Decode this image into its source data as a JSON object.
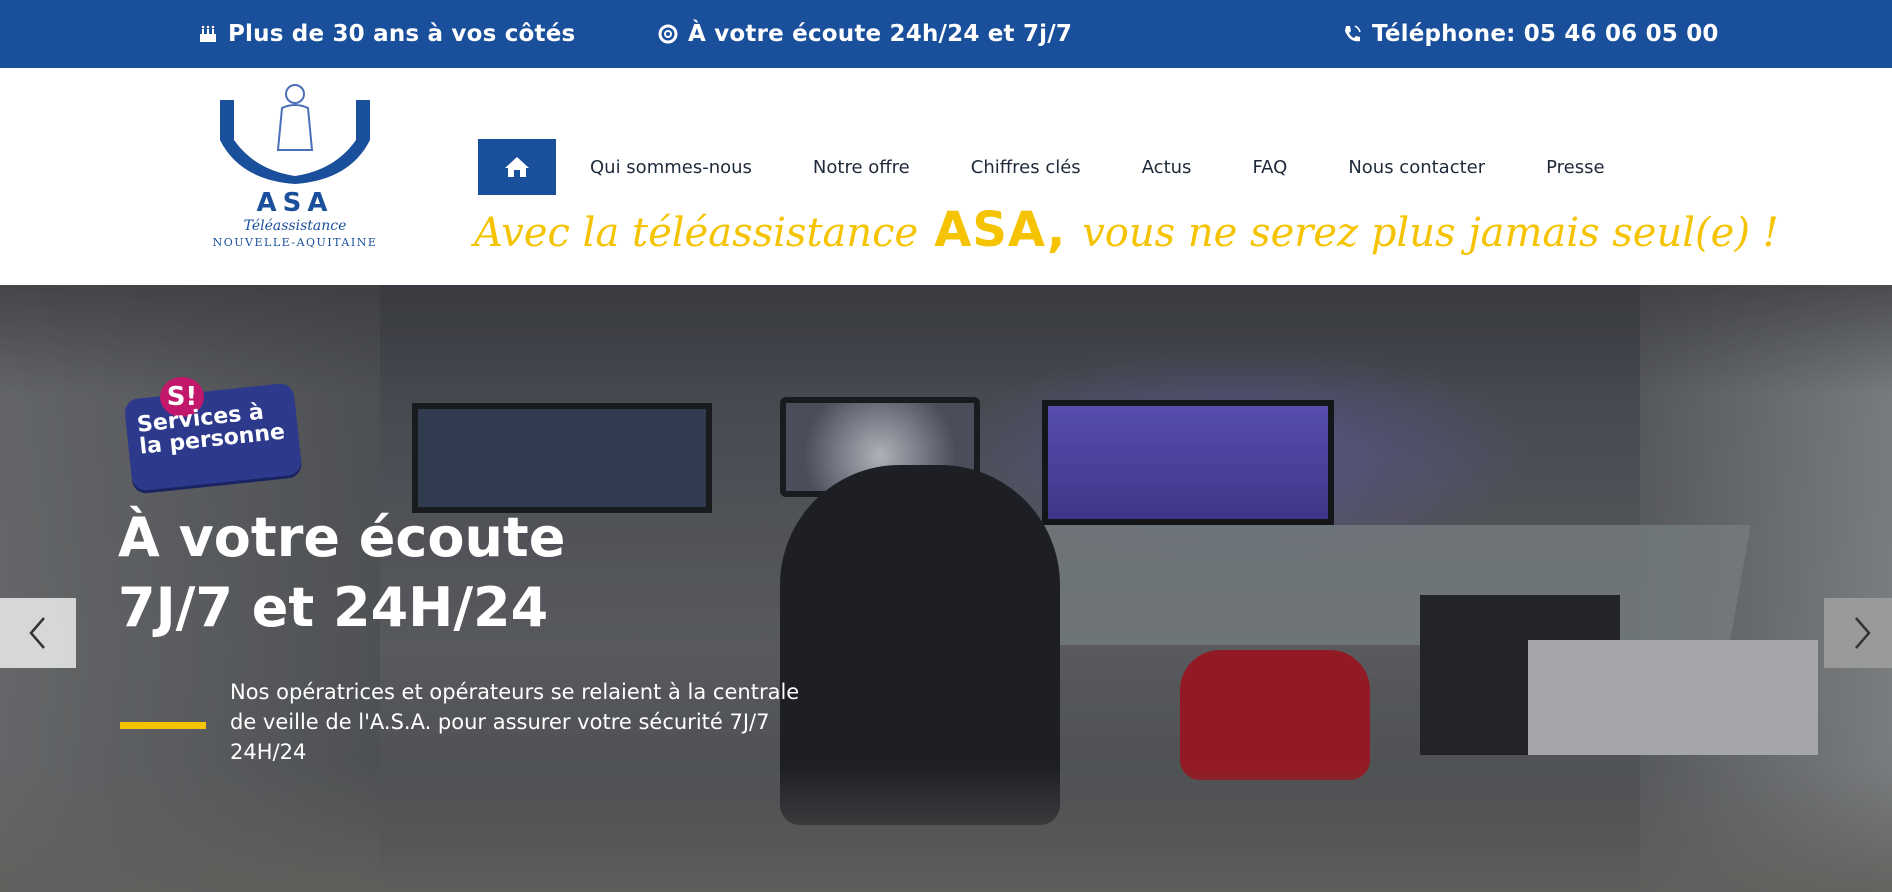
{
  "topbar": {
    "years": "Plus de 30 ans à vos côtés",
    "listen": "À votre écoute 24h/24 et 7j/7",
    "phone": "Téléphone: 05 46 06 05 00"
  },
  "logo": {
    "brand": "ASA",
    "sub1": "Téléassistance",
    "sub2": "NOUVELLE-AQUITAINE"
  },
  "nav": {
    "home_icon": "home-icon",
    "items": [
      "Qui sommes-nous",
      "Notre offre",
      "Chiffres clés",
      "Actus",
      "FAQ",
      "Nous contacter",
      "Presse"
    ]
  },
  "slogan": {
    "before": "Avec la téléassistance",
    "brand": "ASA,",
    "after": "vous ne serez plus jamais seul(e) !"
  },
  "hero": {
    "badge_letter": "S!",
    "badge_line1": "Services à",
    "badge_line2": "la personne",
    "title_line1": "À votre écoute",
    "title_line2": "7J/7 et 24H/24",
    "text": "Nos opératrices et opérateurs se relaient à la centrale de veille de l'A.S.A. pour assurer votre sécurité 7J/7 24H/24"
  },
  "colors": {
    "brand_blue": "#1a4f9c",
    "accent_yellow": "#f5c300"
  }
}
